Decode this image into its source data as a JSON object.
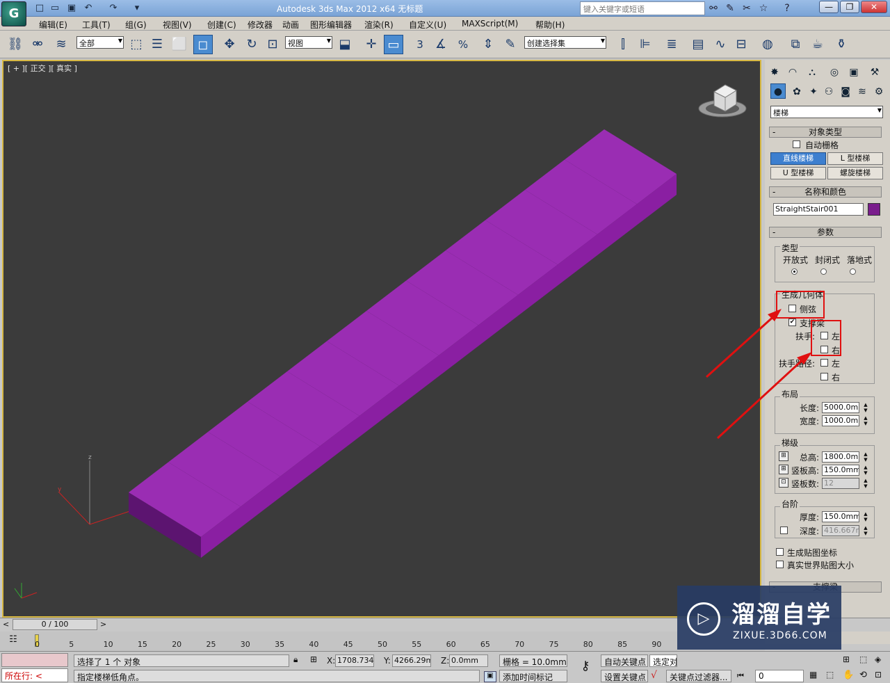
{
  "titlebar": {
    "title": "Autodesk 3ds Max  2012 x64      无标题",
    "search_placeholder": "键入关键字或短语"
  },
  "menubar": [
    "编辑(E)",
    "工具(T)",
    "组(G)",
    "视图(V)",
    "创建(C)",
    "修改器",
    "动画",
    "图形编辑器",
    "渲染(R)",
    "自定义(U)",
    "MAXScript(M)",
    "帮助(H)"
  ],
  "toolbar": {
    "selection_filter": "全部",
    "ref_coord": "视图",
    "named_selection": "创建选择集",
    "snap_label": "3",
    "percent_label": "%"
  },
  "viewport": {
    "label": "[ + ][ 正交 ][ 真实 ]",
    "stair_color": "#9a2db3",
    "axis_x": "x",
    "axis_y": "y",
    "axis_z": "z"
  },
  "command_panel": {
    "category": "楼梯",
    "object_type": {
      "title": "对象类型",
      "autogrid": "自动栅格",
      "buttons": [
        "直线楼梯",
        "L 型楼梯",
        "U 型楼梯",
        "螺旋楼梯"
      ]
    },
    "name_color": {
      "title": "名称和颜色",
      "name": "StraightStair001",
      "color": "#7a1d8c"
    },
    "params": {
      "title": "参数",
      "type_group": "类型",
      "types": [
        "开放式",
        "封闭式",
        "落地式"
      ],
      "geometry_group": "生成几何体",
      "stringers": "侧弦",
      "carriage": "支撑梁",
      "handrail": "扶手:",
      "rail_path": "扶手路径:",
      "left": "左",
      "right": "右",
      "layout_group": "布局",
      "length_label": "长度:",
      "length_value": "5000.0mm",
      "width_label": "宽度:",
      "width_value": "1000.0mm",
      "risers_group": "梯级",
      "overall_label": "总高:",
      "overall_value": "1800.0mm",
      "riser_ht_label": "竖板高:",
      "riser_ht_value": "150.0mm",
      "riser_ct_label": "竖板数:",
      "riser_ct_value": "12",
      "steps_group": "台阶",
      "thick_label": "厚度:",
      "thick_value": "150.0mm",
      "depth_label": "深度:",
      "depth_value": "416.667m",
      "gen_map": "生成贴图坐标",
      "real_world": "真实世界贴图大小",
      "next_rollout": "支撑梁"
    }
  },
  "timeline": {
    "frame": "0 / 100",
    "ticks": [
      "0",
      "5",
      "10",
      "15",
      "20",
      "25",
      "30",
      "35",
      "40",
      "45",
      "50",
      "55",
      "60",
      "65",
      "70",
      "75",
      "80",
      "85",
      "90"
    ]
  },
  "status": {
    "listener": "所在行:",
    "selected": "选择了 1 个 对象",
    "prompt": "指定楼梯低角点。",
    "x_label": "X:",
    "x_value": "1708.734m",
    "y_label": "Y:",
    "y_value": "4266.29mm",
    "z_label": "Z:",
    "z_value": "0.0mm",
    "grid": "栅格 = 10.0mm",
    "add_time_tag": "添加时间标记",
    "auto_key": "自动关键点",
    "selected_obj": "选定对",
    "set_key": "设置关键点",
    "key_filters": "关键点过滤器...",
    "frame_value": "0"
  },
  "watermark": {
    "brand": "溜溜自学",
    "url": "ZIXUE.3D66.COM"
  }
}
